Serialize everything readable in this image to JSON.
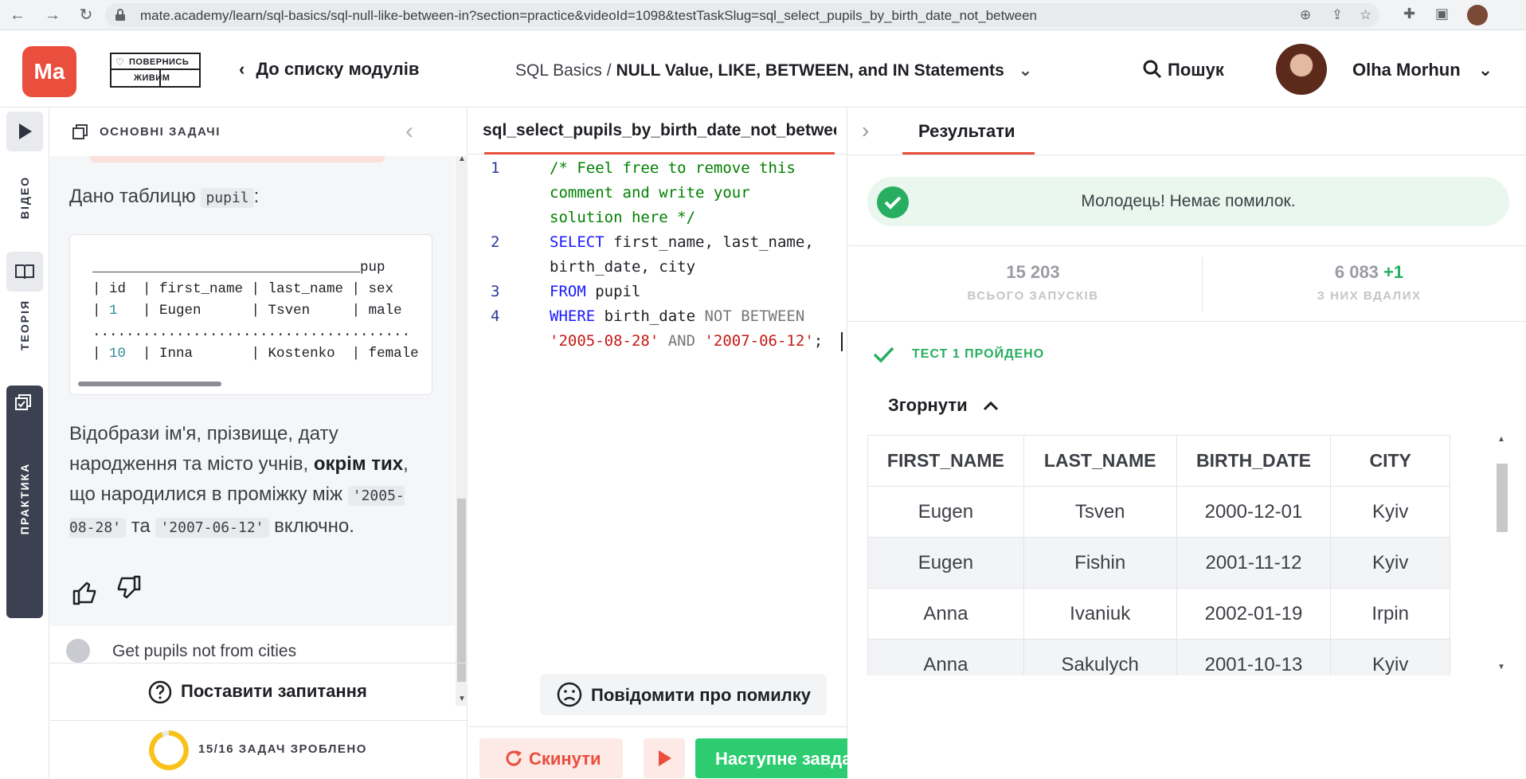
{
  "browser": {
    "url": "mate.academy/learn/sql-basics/sql-null-like-between-in?section=practice&videoId=1098&testTaskSlug=sql_select_pupils_by_birth_date_not_between"
  },
  "header": {
    "logo": "Ma",
    "badge_line1": "ПОВЕРНИСЬ",
    "badge_line2": "ЖИВИМ",
    "back_label": "До списку модулів",
    "crumb_course": "SQL Basics",
    "crumb_sep": " / ",
    "crumb_module": "NULL Value, LIKE, BETWEEN, and IN Statements",
    "search_label": "Пошук",
    "user_name": "Olha Morhun"
  },
  "rail": {
    "video": "ВІДЕО",
    "theory": "ТЕОРІЯ",
    "practice": "ПРАКТИКА"
  },
  "task": {
    "section_title": "ОСНОВНІ ЗАДАЧІ",
    "intro_text": "Дано таблицю",
    "intro_code": "pupil",
    "intro_colon": ":",
    "table_title_line": "________________________________pup",
    "table_header": "| id  | first_name | last_name | sex",
    "table_row1_pre": "| ",
    "table_row1_id": "1",
    "table_row1_rest": "   | Eugen      | Tsven     | male",
    "table_dots": "......................................",
    "table_row2_pre": "| ",
    "table_row2_id": "10",
    "table_row2_rest": "  | Inna       | Kostenko  | female",
    "desc_part1": "Відобрази ім'я, прізвище, дату народження та місто учнів,",
    "desc_bold": "окрім тих",
    "desc_part2": ", що народилися в проміжку між",
    "desc_code1": "'2005-08-28'",
    "desc_and": "та",
    "desc_code2": "'2007-06-12'",
    "desc_part3": "включно.",
    "next_task_preview": "Get pupils not from cities",
    "ask_label": "Поставити запитання",
    "progress_label": "15/16 ЗАДАЧ ЗРОБЛЕНО",
    "progress_fraction": 0.9375
  },
  "editor": {
    "tab_name": "sql_select_pupils_by_birth_date_not_between",
    "lines": {
      "n1": "1",
      "n2": "2",
      "n3": "3",
      "n4": "4",
      "l1a": "/* Feel free to remove this",
      "l1b": "comment and write your",
      "l1c": "solution here */",
      "l2kw": "SELECT",
      "l2a": " first_name, last_name,",
      "l2b": "birth_date, city",
      "l3kw": "FROM",
      "l3a": " pupil",
      "l4kw": "WHERE",
      "l4a": " birth_date ",
      "l4op": "NOT BETWEEN",
      "l4s1": "'2005-08-28'",
      "l4and": " AND ",
      "l4s2": "'2007-06-12'",
      "l4end": ";"
    },
    "report_label": "Повідомити про помилку",
    "reset_label": "Скинути",
    "next_label": "Наступне завдання"
  },
  "results": {
    "tab_label": "Результати",
    "success_message": "Молодець! Немає помилок.",
    "runs_value": "15 203",
    "runs_label": "ВСЬОГО ЗАПУСКІВ",
    "success_value": "6 083",
    "success_plus": "+1",
    "success_label": "З НИХ ВДАЛИХ",
    "test_status": "ТЕСТ 1 ПРОЙДЕНО",
    "collapse_label": "Згорнути",
    "columns": [
      "FIRST_NAME",
      "LAST_NAME",
      "BIRTH_DATE",
      "CITY"
    ],
    "rows": [
      [
        "Eugen",
        "Tsven",
        "2000-12-01",
        "Kyiv"
      ],
      [
        "Eugen",
        "Fishin",
        "2001-11-12",
        "Kyiv"
      ],
      [
        "Anna",
        "Ivaniuk",
        "2002-01-19",
        "Irpin"
      ],
      [
        "Anna",
        "Sakulych",
        "2001-10-13",
        "Kyiv"
      ]
    ]
  },
  "colors": {
    "brand": "#ea4e3d",
    "success": "#27ae60",
    "progress_ring": "#f8c21b"
  }
}
